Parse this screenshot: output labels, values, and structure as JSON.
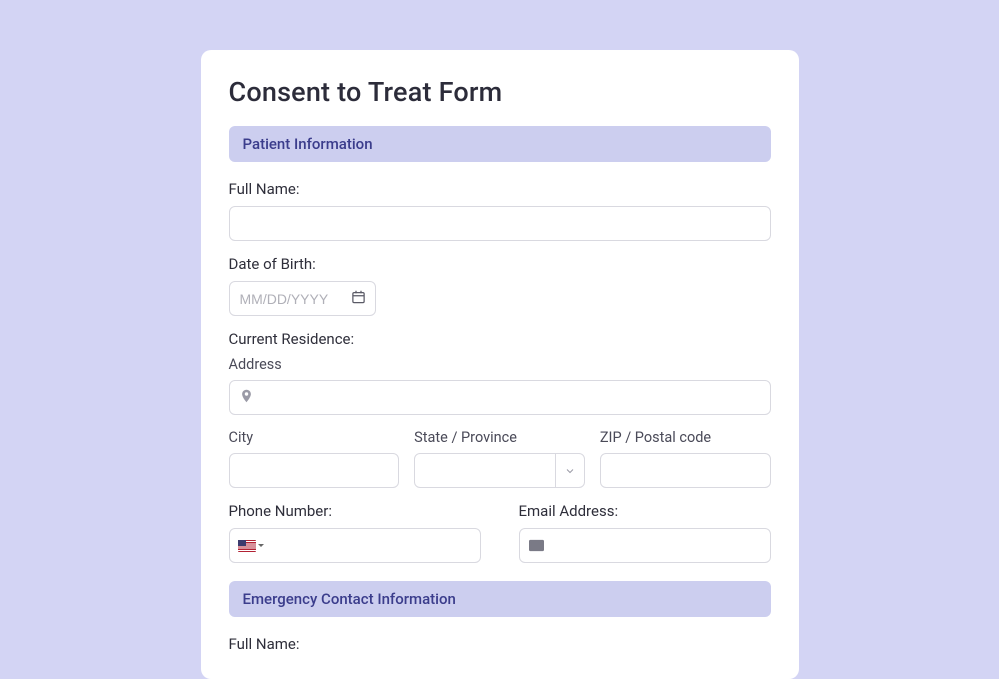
{
  "title": "Consent to Treat Form",
  "sections": {
    "patient": {
      "header": "Patient Information",
      "full_name_label": "Full Name:",
      "dob_label": "Date of Birth:",
      "dob_placeholder": "MM/DD/YYYY",
      "residence_label": "Current Residence:",
      "address_label": "Address",
      "city_label": "City",
      "state_label": "State / Province",
      "zip_label": "ZIP / Postal code",
      "phone_label": "Phone Number:",
      "email_label": "Email Address:"
    },
    "emergency": {
      "header": "Emergency Contact Information",
      "full_name_label": "Full Name:"
    }
  }
}
